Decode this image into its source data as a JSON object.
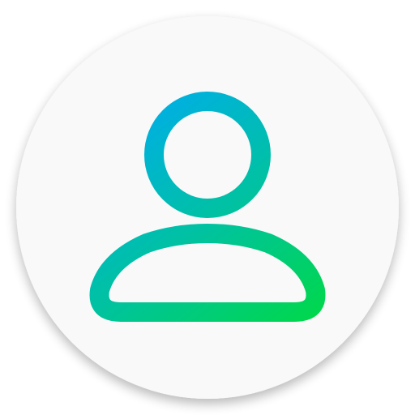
{
  "icon": {
    "name": "user-profile-icon",
    "colors": {
      "background": "#f9f9f9",
      "gradient_start": "#00aee8",
      "gradient_mid": "#00c2a0",
      "gradient_end": "#00d84a",
      "shadow": "#000000"
    }
  }
}
